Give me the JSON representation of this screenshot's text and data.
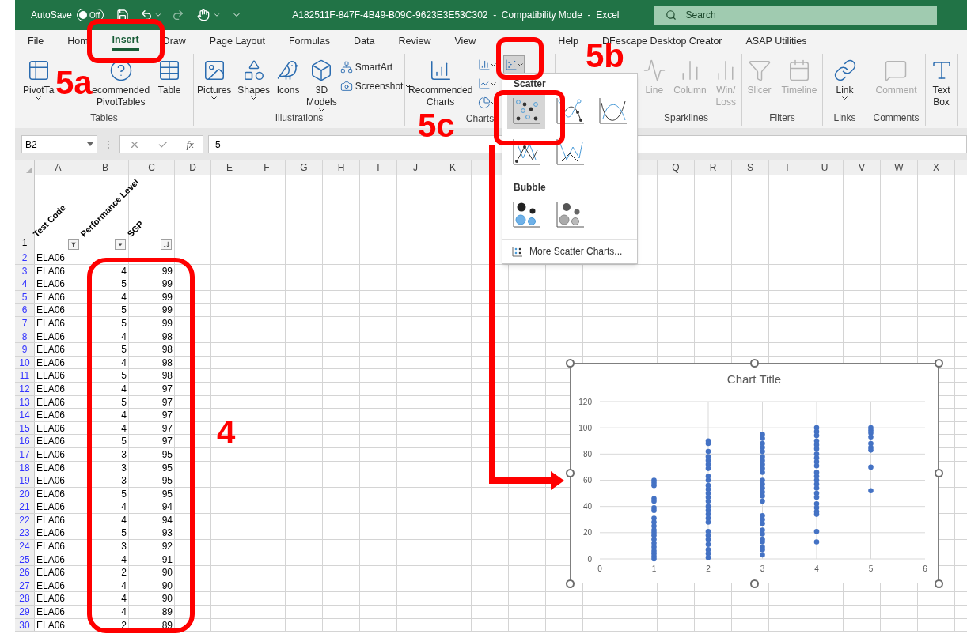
{
  "title_bar": {
    "autosave_label": "AutoSave",
    "autosave": {
      "on": false,
      "label": "Off"
    },
    "document_title": "A182511F-847F-4B49-B09C-9623E3E53C302  -  Compatibility Mode  -  Excel",
    "search": {
      "placeholder": "Search"
    }
  },
  "tabs": [
    {
      "label": "File",
      "selected": false
    },
    {
      "label": "Hom",
      "selected": false
    },
    {
      "label": "Insert",
      "selected": true
    },
    {
      "label": "Draw",
      "selected": false
    },
    {
      "label": "Page Layout",
      "selected": false
    },
    {
      "label": "Formulas",
      "selected": false
    },
    {
      "label": "Data",
      "selected": false
    },
    {
      "label": "Review",
      "selected": false
    },
    {
      "label": "View",
      "selected": false
    },
    {
      "label": "Help",
      "selected": false
    },
    {
      "label": "DFescape Desktop Creator",
      "selected": false
    },
    {
      "label": "ASAP Utilities",
      "selected": false
    }
  ],
  "ribbon": [
    {
      "label": "Tables",
      "items": [
        {
          "kind": "large",
          "lines": [
            "PivotTa"
          ],
          "menu": true,
          "disabled": false
        },
        {
          "kind": "large",
          "lines": [
            "ecommended",
            "PivotTables"
          ],
          "menu": false,
          "disabled": false
        },
        {
          "kind": "large",
          "lines": [
            "Table"
          ],
          "menu": false,
          "disabled": false
        }
      ]
    },
    {
      "label": "Illustrations",
      "items": [
        {
          "kind": "large",
          "lines": [
            "Pictures"
          ],
          "menu": true,
          "disabled": false
        },
        {
          "kind": "large",
          "lines": [
            "Shapes"
          ],
          "menu": true,
          "disabled": false
        },
        {
          "kind": "large",
          "lines": [
            "Icons"
          ],
          "menu": false,
          "disabled": false
        },
        {
          "kind": "large",
          "lines": [
            "3D",
            "Models"
          ],
          "menu": true,
          "disabled": false
        },
        {
          "kind": "small",
          "lines": [
            "SmartArt"
          ],
          "menu": false,
          "disabled": false
        },
        {
          "kind": "small",
          "lines": [
            "Screenshot"
          ],
          "menu": true,
          "disabled": false
        }
      ]
    },
    {
      "label": "Charts",
      "items": [
        {
          "kind": "large",
          "lines": [
            "Recommended",
            "Charts"
          ],
          "menu": false,
          "disabled": false
        },
        {
          "kind": "mini",
          "menu": true,
          "disabled": false,
          "selected": false
        },
        {
          "kind": "mini",
          "menu": true,
          "disabled": false,
          "selected": false
        },
        {
          "kind": "mini",
          "menu": true,
          "disabled": false,
          "selected": false
        },
        {
          "kind": "mini",
          "menu": true,
          "disabled": false,
          "selected": true
        }
      ]
    },
    {
      "label": "Sparklines",
      "items": [
        {
          "kind": "large",
          "lines": [
            "Line"
          ],
          "menu": false,
          "disabled": true
        },
        {
          "kind": "large",
          "lines": [
            "Column"
          ],
          "menu": false,
          "disabled": true
        },
        {
          "kind": "large",
          "lines": [
            "Win/",
            "Loss"
          ],
          "menu": false,
          "disabled": true
        }
      ]
    },
    {
      "label": "Filters",
      "items": [
        {
          "kind": "large",
          "lines": [
            "Slicer"
          ],
          "menu": false,
          "disabled": true
        },
        {
          "kind": "large",
          "lines": [
            "Timeline"
          ],
          "menu": false,
          "disabled": true
        }
      ]
    },
    {
      "label": "Links",
      "items": [
        {
          "kind": "large",
          "lines": [
            "Link"
          ],
          "menu": true,
          "disabled": false
        }
      ]
    },
    {
      "label": "Comments",
      "items": [
        {
          "kind": "large",
          "lines": [
            "Comment"
          ],
          "menu": false,
          "disabled": true
        }
      ]
    },
    {
      "items": [
        {
          "kind": "large",
          "lines": [
            "Text",
            "Box"
          ],
          "menu": false,
          "disabled": false
        }
      ]
    }
  ],
  "formula_bar": {
    "name_box": "B2",
    "function_label": "fx",
    "formula": "5"
  },
  "sheet": {
    "columns": [
      "A",
      "B",
      "C",
      "D",
      "E",
      "F",
      "G",
      "H",
      "I",
      "J",
      "K",
      "Q",
      "R",
      "S",
      "T",
      "U",
      "V",
      "W",
      "X"
    ],
    "header_row": {
      "row": "1",
      "cells": [
        {
          "text": "Test Code",
          "kind": "filtered"
        },
        {
          "text": "Performance Level",
          "kind": "dropdown"
        },
        {
          "text": "SGP",
          "kind": "sorted"
        }
      ]
    },
    "rows": [
      {
        "row": "2",
        "a": "ELA06"
      },
      {
        "row": "3",
        "a": "ELA06",
        "b": "4",
        "c": "99"
      },
      {
        "row": "4",
        "a": "ELA06",
        "b": "5",
        "c": "99"
      },
      {
        "row": "5",
        "a": "ELA06",
        "b": "4",
        "c": "99"
      },
      {
        "row": "6",
        "a": "ELA06",
        "b": "5",
        "c": "99"
      },
      {
        "row": "7",
        "a": "ELA06",
        "b": "5",
        "c": "99"
      },
      {
        "row": "8",
        "a": "ELA06",
        "b": "4",
        "c": "98"
      },
      {
        "row": "9",
        "a": "ELA06",
        "b": "5",
        "c": "98"
      },
      {
        "row": "10",
        "a": "ELA06",
        "b": "4",
        "c": "98"
      },
      {
        "row": "11",
        "a": "ELA06",
        "b": "5",
        "c": "98"
      },
      {
        "row": "12",
        "a": "ELA06",
        "b": "4",
        "c": "97"
      },
      {
        "row": "13",
        "a": "ELA06",
        "b": "5",
        "c": "97"
      },
      {
        "row": "14",
        "a": "ELA06",
        "b": "4",
        "c": "97"
      },
      {
        "row": "15",
        "a": "ELA06",
        "b": "4",
        "c": "97"
      },
      {
        "row": "16",
        "a": "ELA06",
        "b": "5",
        "c": "97"
      },
      {
        "row": "17",
        "a": "ELA06",
        "b": "3",
        "c": "95"
      },
      {
        "row": "18",
        "a": "ELA06",
        "b": "3",
        "c": "95"
      },
      {
        "row": "19",
        "a": "ELA06",
        "b": "3",
        "c": "95"
      },
      {
        "row": "20",
        "a": "ELA06",
        "b": "5",
        "c": "95"
      },
      {
        "row": "21",
        "a": "ELA06",
        "b": "4",
        "c": "94"
      },
      {
        "row": "22",
        "a": "ELA06",
        "b": "4",
        "c": "94"
      },
      {
        "row": "23",
        "a": "ELA06",
        "b": "5",
        "c": "93"
      },
      {
        "row": "24",
        "a": "ELA06",
        "b": "3",
        "c": "92"
      },
      {
        "row": "25",
        "a": "ELA06",
        "b": "4",
        "c": "91"
      },
      {
        "row": "26",
        "a": "ELA06",
        "b": "2",
        "c": "90"
      },
      {
        "row": "27",
        "a": "ELA06",
        "b": "4",
        "c": "90"
      },
      {
        "row": "28",
        "a": "ELA06",
        "b": "4",
        "c": "90"
      },
      {
        "row": "29",
        "a": "ELA06",
        "b": "4",
        "c": "89"
      },
      {
        "row": "30",
        "a": "ELA06",
        "b": "2",
        "c": "89"
      }
    ]
  },
  "chart": {
    "chart_data": {
      "type": "scatter",
      "title": "Chart Title",
      "grid": true,
      "xlim": [
        0,
        6
      ],
      "ylim": [
        0,
        120
      ],
      "xticks": [
        0,
        1,
        2,
        3,
        4,
        5,
        6
      ],
      "yticks": [
        0,
        20,
        40,
        60,
        80,
        100,
        120
      ],
      "series": [
        {
          "color": "#4472c4",
          "x": [
            1,
            1,
            1,
            1,
            1,
            1,
            1,
            1,
            1,
            1,
            1,
            1,
            1,
            1,
            1,
            1,
            1,
            1,
            1,
            1,
            2,
            2,
            2,
            2,
            2,
            2,
            2,
            2,
            2,
            2,
            2,
            2,
            2,
            2,
            2,
            2,
            2,
            2,
            2,
            2,
            2,
            2,
            2,
            2,
            2,
            2,
            3,
            3,
            3,
            3,
            3,
            3,
            3,
            3,
            3,
            3,
            3,
            3,
            3,
            3,
            3,
            3,
            3,
            3,
            3,
            3,
            3,
            3,
            3,
            3,
            3,
            3,
            4,
            4,
            4,
            4,
            4,
            4,
            4,
            4,
            4,
            4,
            4,
            4,
            4,
            4,
            4,
            4,
            4,
            4,
            4,
            4,
            4,
            4,
            4,
            5,
            5,
            5,
            5,
            5,
            5,
            5,
            5,
            5
          ],
          "values": [
            60,
            58,
            56,
            46,
            44,
            39,
            37,
            31,
            28,
            25,
            22,
            20,
            18,
            15,
            12,
            9,
            6,
            4,
            2,
            0,
            90,
            88,
            82,
            78,
            75,
            72,
            69,
            63,
            60,
            56,
            53,
            50,
            47,
            44,
            40,
            37,
            34,
            31,
            28,
            21,
            18,
            15,
            11,
            7,
            4,
            1,
            95,
            92,
            88,
            85,
            82,
            78,
            75,
            72,
            69,
            66,
            60,
            57,
            54,
            51,
            48,
            44,
            33,
            30,
            27,
            22,
            19,
            15,
            13,
            9,
            7,
            3,
            100,
            97,
            94,
            90,
            87,
            84,
            80,
            77,
            74,
            71,
            66,
            63,
            60,
            57,
            54,
            50,
            47,
            42,
            39,
            36,
            34,
            21,
            13,
            100,
            98,
            96,
            93,
            88,
            85,
            83,
            70,
            52
          ]
        }
      ]
    }
  },
  "scatter_gallery": {
    "sections": [
      {
        "title": "Scatter",
        "items": [
          {
            "selected": true
          },
          {
            "selected": false
          },
          {
            "selected": false
          },
          {
            "selected": false
          },
          {
            "selected": false
          }
        ]
      },
      {
        "title": "Bubble",
        "items": [
          {
            "selected": false
          },
          {
            "selected": false
          }
        ]
      }
    ],
    "more": "More Scatter Charts..."
  },
  "callouts": [
    "5a",
    "5b",
    "5c",
    "4"
  ]
}
